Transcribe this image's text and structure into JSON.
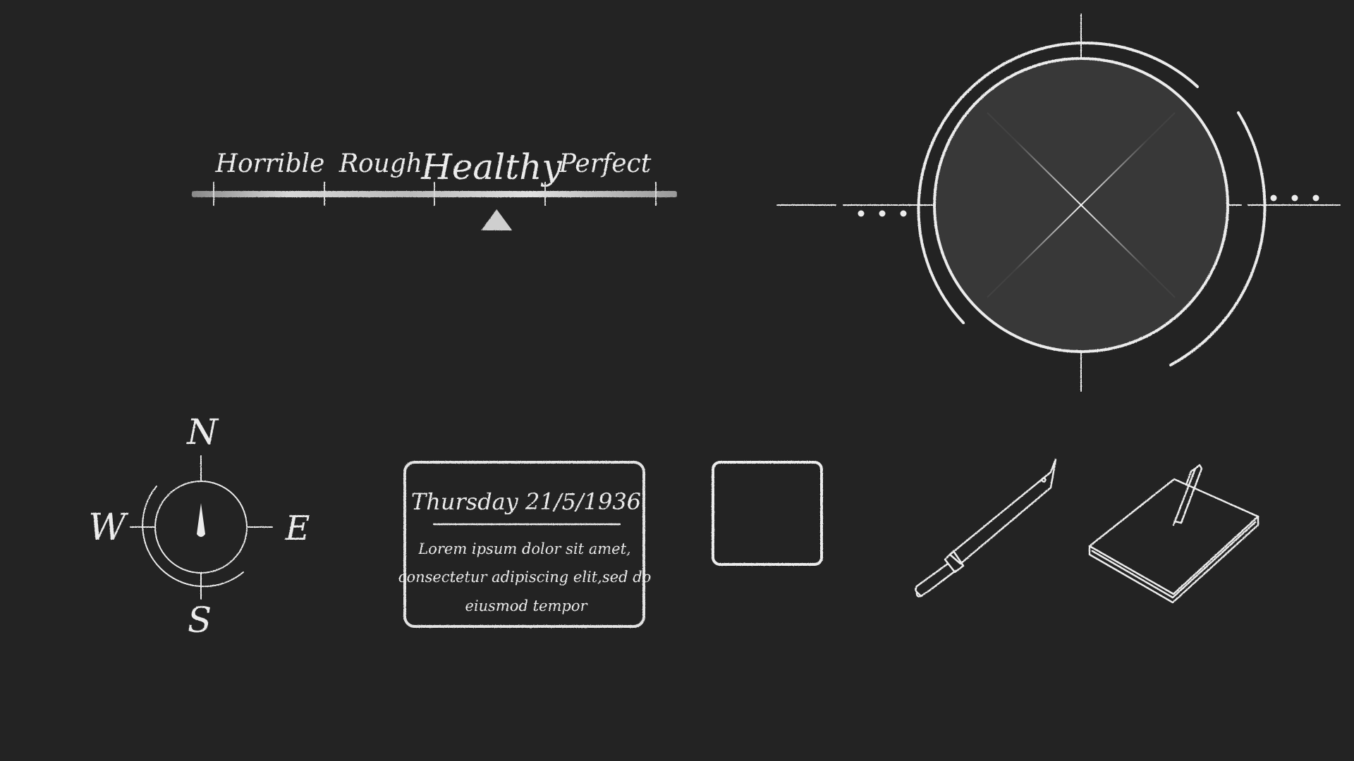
{
  "health_meter": {
    "labels": [
      "Horrible",
      "Rough",
      "Healthy",
      "Perfect"
    ],
    "current_label": "Healthy",
    "level": 0.64
  },
  "crosshair": {
    "center_icon": "x-mark-icon",
    "left_dots": 3,
    "right_dots": 3
  },
  "compass": {
    "north": "N",
    "south": "S",
    "east": "E",
    "west": "W",
    "icon": "compass-needle-icon"
  },
  "note_card": {
    "date": "Thursday 21/5/1936",
    "body_lines": [
      "Lorem ipsum dolor sit amet,",
      "consectetur adipiscing elit,sed do",
      "eiusmod tempor"
    ]
  },
  "inventory": {
    "empty_slot_icon": "empty-slot-icon",
    "items": [
      {
        "icon": "machete-icon"
      },
      {
        "icon": "notebook-pen-icon"
      }
    ]
  },
  "colors": {
    "background": "#232323",
    "chalk": "#ececec",
    "disc_fill": "#393939"
  }
}
